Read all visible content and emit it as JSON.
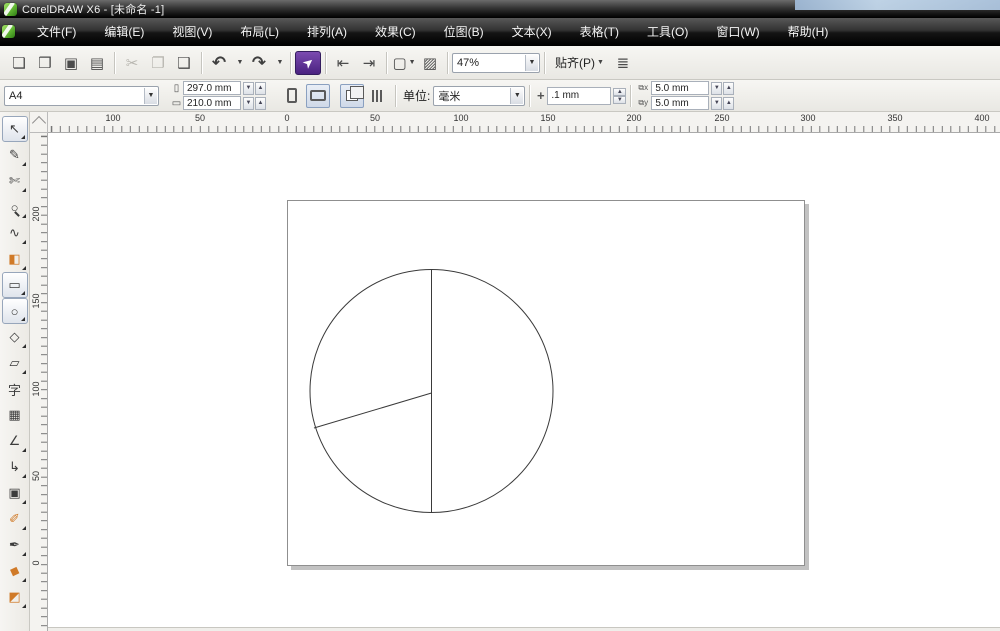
{
  "window": {
    "title": "CorelDRAW X6 - [未命名 -1]"
  },
  "menu": {
    "items": [
      {
        "label": "文件(F)"
      },
      {
        "label": "编辑(E)"
      },
      {
        "label": "视图(V)"
      },
      {
        "label": "布局(L)"
      },
      {
        "label": "排列(A)"
      },
      {
        "label": "效果(C)"
      },
      {
        "label": "位图(B)"
      },
      {
        "label": "文本(X)"
      },
      {
        "label": "表格(T)"
      },
      {
        "label": "工具(O)"
      },
      {
        "label": "窗口(W)"
      },
      {
        "label": "帮助(H)"
      }
    ]
  },
  "icons": {
    "new": "❏",
    "open": "❒",
    "save": "▣",
    "print": "▤",
    "cut": "✂",
    "copy": "❐",
    "paste": "❑",
    "undo": "↶",
    "redo": "↷",
    "search_arrow": "➤",
    "import": "⇤",
    "export": "⇥",
    "launcher": "▢",
    "welcome": "▨",
    "options": "≣",
    "combo_arrow": "▼",
    "spin_up": "▲",
    "spin_down": "▼",
    "nudge": "+",
    "page_w": "▭",
    "page_h": "▯"
  },
  "toolbar": {
    "zoom_level": "47%",
    "snap_label": "贴齐(P)"
  },
  "property_bar": {
    "paper_size": "A4",
    "page_width": "297.0 mm",
    "page_height": "210.0 mm",
    "units_label": "单位:",
    "units_value": "毫米",
    "nudge_value": ".1 mm",
    "dup_x_value": "5.0 mm",
    "dup_y_value": "5.0 mm",
    "dup_x_sub": "x",
    "dup_y_sub": "y"
  },
  "rulers": {
    "h": [
      "100",
      "50",
      "0",
      "50",
      "100",
      "150",
      "200",
      "250",
      "300",
      "350",
      "400"
    ],
    "v": [
      "200",
      "150",
      "100",
      "50",
      "0"
    ]
  },
  "toolbox": {
    "tools": [
      {
        "id": "pick",
        "glyph": "↖"
      },
      {
        "id": "shape",
        "glyph": "✎"
      },
      {
        "id": "crop",
        "glyph": "✄"
      },
      {
        "id": "zoom",
        "glyph": "○"
      },
      {
        "id": "freehand",
        "glyph": "∿"
      },
      {
        "id": "smart-fill",
        "glyph": "◧"
      },
      {
        "id": "rectangle",
        "glyph": "▭"
      },
      {
        "id": "ellipse",
        "glyph": "○"
      },
      {
        "id": "polygon",
        "glyph": "◇"
      },
      {
        "id": "basic-shapes",
        "glyph": "▱"
      },
      {
        "id": "text",
        "glyph": "字"
      },
      {
        "id": "table",
        "glyph": "▦"
      },
      {
        "id": "dimension",
        "glyph": "∠"
      },
      {
        "id": "connector",
        "glyph": "↳"
      },
      {
        "id": "blend",
        "glyph": "▣"
      },
      {
        "id": "eyedropper",
        "glyph": "✐"
      },
      {
        "id": "outline-pen",
        "glyph": "✒"
      },
      {
        "id": "fill",
        "glyph": "◆"
      },
      {
        "id": "interactive-fill",
        "glyph": "◩"
      }
    ]
  },
  "colors": {
    "search_purple": "#4a2280",
    "logo_green": "#6cc23a",
    "page_shadow": "#c2c2c2"
  }
}
